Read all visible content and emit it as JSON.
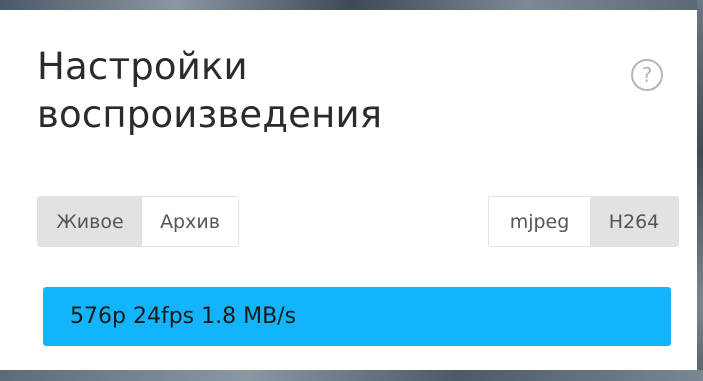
{
  "dialog": {
    "title": "Настройки воспроизведения",
    "help_icon": "question-circle-icon",
    "help_glyph": "?"
  },
  "mode": {
    "options": [
      {
        "label": "Живое",
        "active": true
      },
      {
        "label": "Архив",
        "active": false
      }
    ]
  },
  "codec": {
    "options": [
      {
        "label": "mjpeg",
        "active": false
      },
      {
        "label": "H264",
        "active": true
      }
    ]
  },
  "stream": {
    "info": "576p 24fps 1.8 MB/s"
  },
  "colors": {
    "accent": "#12b4fb",
    "active_segment": "#e2e2e2"
  }
}
